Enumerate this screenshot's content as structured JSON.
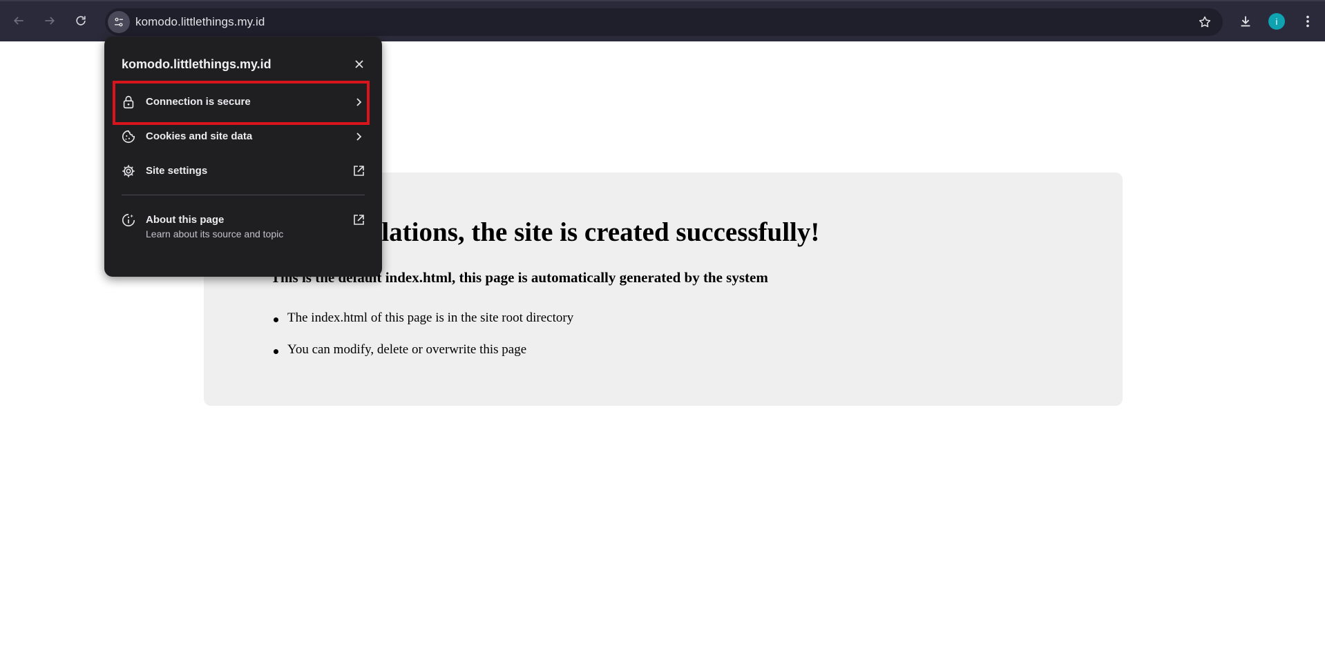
{
  "browser": {
    "url": "komodo.littlethings.my.id",
    "avatar_initial": "i",
    "accent_color": "#0fa3b1"
  },
  "page": {
    "title": "Congratulations, the site is created successfully!",
    "subtitle": "This is the default index.html, this page is automatically generated by the system",
    "bullets": [
      "The index.html of this page is in the site root directory",
      "You can modify, delete or overwrite this page"
    ]
  },
  "popup": {
    "title": "komodo.littlethings.my.id",
    "items": [
      {
        "label": "Connection is secure",
        "icon": "lock-icon",
        "trailing": "chevron-right-icon"
      },
      {
        "label": "Cookies and site data",
        "icon": "cookie-icon",
        "trailing": "chevron-right-icon"
      },
      {
        "label": "Site settings",
        "icon": "gear-icon",
        "trailing": "open-in-new-icon"
      }
    ],
    "about": {
      "label": "About this page",
      "sublabel": "Learn about its source and topic",
      "icon": "about-info-icon",
      "trailing": "open-in-new-icon"
    },
    "highlight_color": "#d8151c"
  }
}
